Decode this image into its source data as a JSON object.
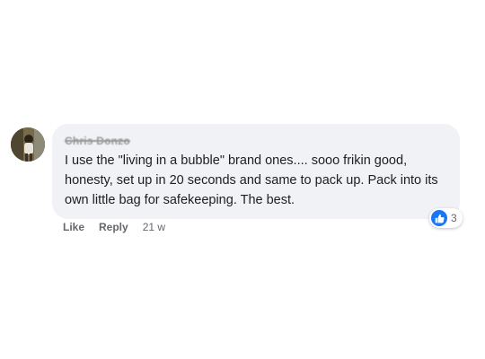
{
  "comment": {
    "author": "Chris Donzo",
    "text": "I use the \"living in a bubble\" brand ones.... sooo frikin good, honesty, set up in 20 seconds and same to pack up. Pack into its own little bag for safekeeping. The best.",
    "reaction_count": "3",
    "like_icon": "thumbs-up-icon"
  },
  "actions": {
    "like_label": "Like",
    "reply_label": "Reply",
    "timestamp": "21 w"
  },
  "colors": {
    "bubble": "#f0f2f5",
    "text": "#1c1e21",
    "secondary": "#65676b",
    "like_blue": "#1877f2"
  }
}
